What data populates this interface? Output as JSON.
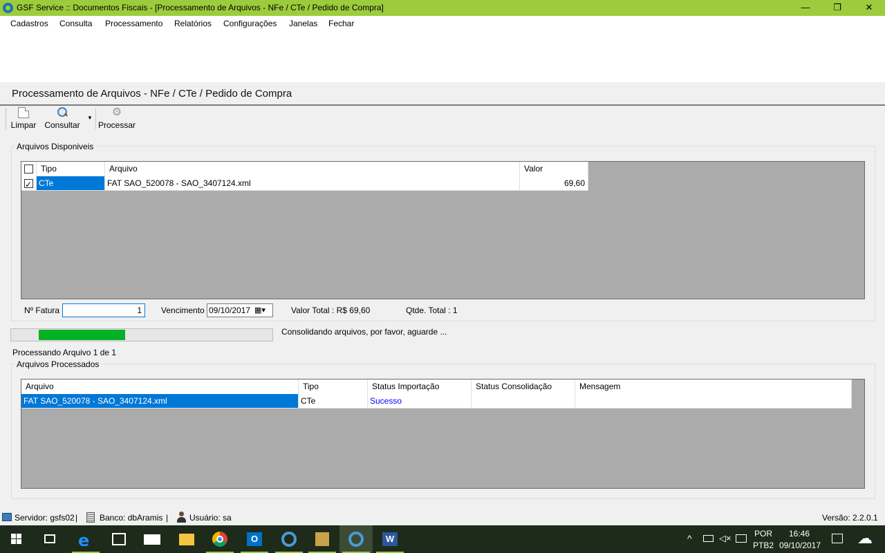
{
  "window": {
    "title": "GSF Service :: Documentos Fiscais - [Processamento de Arquivos - NFe / CTe / Pedido de Compra]",
    "minimize": "—",
    "maximize": "❐",
    "close": "✕"
  },
  "menu": {
    "items": [
      "Cadastros",
      "Consulta",
      "Processamento",
      "Relatórios",
      "Configurações",
      "Janelas",
      "Fechar"
    ]
  },
  "page": {
    "title": "Processamento de Arquivos - NFe / CTe / Pedido de Compra"
  },
  "toolbar": {
    "limpar": "Limpar",
    "consultar": "Consultar",
    "processar": "Processar"
  },
  "available": {
    "group_label": "Arquivos Disponiveis",
    "columns": {
      "tipo": "Tipo",
      "arquivo": "Arquivo",
      "valor": "Valor"
    },
    "rows": [
      {
        "checked": true,
        "tipo": "CTe",
        "arquivo": "FAT SAO_520078 - SAO_3407124.xml",
        "valor": "69,60"
      }
    ]
  },
  "summary": {
    "fatura_label": "Nº Fatura",
    "fatura_value": "1",
    "vencimento_label": "Vencimento",
    "vencimento_value": "09/10/2017",
    "valor_total": "Valor Total : R$ 69,60",
    "qtde_total": "Qtde. Total : 1"
  },
  "progress": {
    "fraction": 0.33,
    "message": "Consolidando arquivos, por favor, aguarde ...",
    "status": "Processando Arquivo 1 de 1"
  },
  "processed": {
    "group_label": "Arquivos Processados",
    "columns": {
      "arquivo": "Arquivo",
      "tipo": "Tipo",
      "status_importacao": "Status Importação",
      "status_consolidacao": "Status Consolidação",
      "mensagem": "Mensagem"
    },
    "rows": [
      {
        "arquivo": "FAT SAO_520078 - SAO_3407124.xml",
        "tipo": "CTe",
        "status_importacao": "Sucesso",
        "status_consolidacao": "",
        "mensagem": ""
      }
    ]
  },
  "statusbar": {
    "servidor": "Servidor: gsfs02",
    "banco": "Banco: dbAramis",
    "usuario": "Usuário: sa",
    "versao": "Versão: 2.2.0.1",
    "sep": "|"
  },
  "taskbar": {
    "lang1": "POR",
    "lang2": "PTB2",
    "time": "16:46",
    "date": "09/10/2017"
  },
  "colors": {
    "title_bar": "#9ccc3c",
    "selection": "#0078d7",
    "progress": "#06b025",
    "success_text": "#0000ff"
  }
}
